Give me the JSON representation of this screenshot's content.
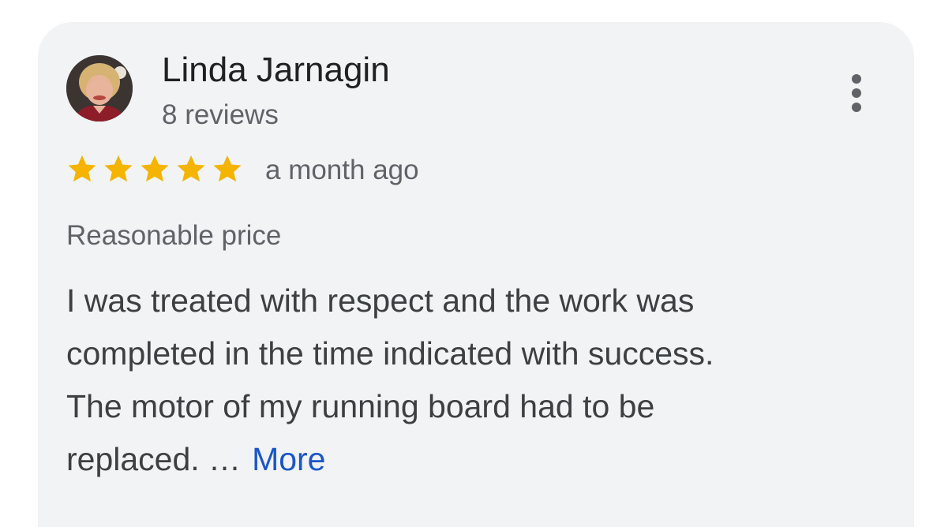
{
  "review": {
    "reviewer_name": "Linda Jarnagin",
    "review_count": "8 reviews",
    "rating": 5,
    "rating_max": 5,
    "time_ago": "a month ago",
    "highlight": "Reasonable price",
    "text_lines": [
      "I was treated with respect and the work was",
      "completed in the time indicated with success.",
      "The motor of my running board had to be",
      "replaced. …"
    ],
    "more_label": "More"
  },
  "icons": {
    "avatar": "reviewer-avatar",
    "menu": "more-vert-icon",
    "star": "star-icon"
  },
  "colors": {
    "card_background": "#f2f3f5",
    "star": "#f4b400",
    "link": "#1a56c7",
    "primary_text": "#202124",
    "secondary_text": "#5f6368"
  }
}
